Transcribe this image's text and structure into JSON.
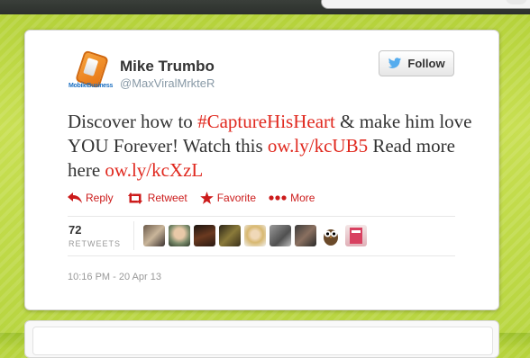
{
  "tweet": {
    "author_name": "Mike Trumbo",
    "author_handle": "@MaxViralMrkteR",
    "avatar_brand": "MobileBusiness",
    "follow_label": "Follow",
    "text_parts": [
      {
        "text": "Discover how to ",
        "type": "text"
      },
      {
        "text": "#CaptureHisHeart",
        "type": "link"
      },
      {
        "text": " & make him love YOU Forever! Watch this ",
        "type": "text"
      },
      {
        "text": "ow.ly/kcUB5",
        "type": "link"
      },
      {
        "text": " Read more here ",
        "type": "text"
      },
      {
        "text": "ow.ly/kcXzL",
        "type": "link"
      }
    ],
    "actions": {
      "reply": "Reply",
      "retweet": "Retweet",
      "favorite": "Favorite",
      "more": "More"
    },
    "retweet_count": "72",
    "retweet_label": "RETWEETS",
    "timestamp": "10:16 PM - 20 Apr 13",
    "retweeter_avatars": [
      "retweeter-avatar",
      "retweeter-avatar",
      "retweeter-avatar",
      "retweeter-avatar",
      "retweeter-avatar",
      "retweeter-avatar",
      "retweeter-avatar",
      "retweeter-avatar",
      "retweeter-avatar"
    ]
  },
  "colors": {
    "link": "#e0281e",
    "action": "#cc1b1b",
    "background": "#b5d23a"
  }
}
